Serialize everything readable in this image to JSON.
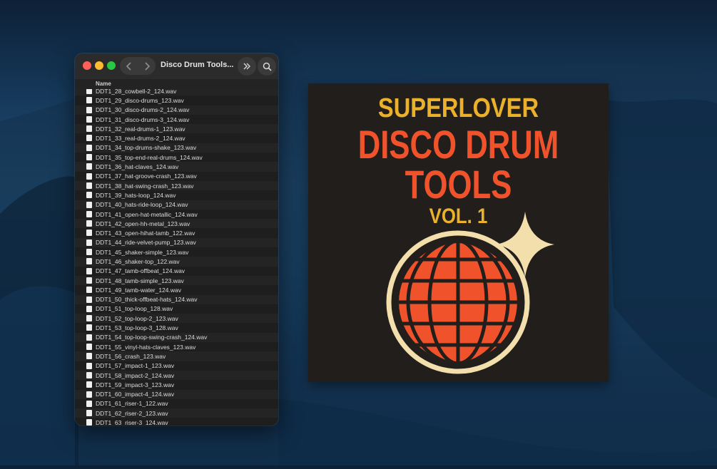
{
  "finder": {
    "title": "Disco Drum Tools...",
    "column_header": "Name",
    "nav_back_icon": "chevron-left-icon",
    "nav_forward_icon": "chevron-right-icon",
    "more_icon": "double-chevron-right-icon",
    "search_icon": "search-icon",
    "files": [
      "DDT1_28_cowbell-2_124.wav",
      "DDT1_29_disco-drums_123.wav",
      "DDT1_30_disco-drums-2_124.wav",
      "DDT1_31_disco-drums-3_124.wav",
      "DDT1_32_real-drums-1_123.wav",
      "DDT1_33_real-drums-2_124.wav",
      "DDT1_34_top-drums-shake_123.wav",
      "DDT1_35_top-end-real-drums_124.wav",
      "DDT1_36_hat-claves_124.wav",
      "DDT1_37_hat-groove-crash_123.wav",
      "DDT1_38_hat-swing-crash_123.wav",
      "DDT1_39_hats-loop_124.wav",
      "DDT1_40_hats-ride-loop_124.wav",
      "DDT1_41_open-hat-metallic_124.wav",
      "DDT1_42_open-hh-metal_123.wav",
      "DDT1_43_open-hihat-tamb_122.wav",
      "DDT1_44_ride-velvet-pump_123.wav",
      "DDT1_45_shaker-simple_123.wav",
      "DDT1_46_shaker-top_122.wav",
      "DDT1_47_tamb-offbeat_124.wav",
      "DDT1_48_tamb-simple_123.wav",
      "DDT1_49_tamb-water_124.wav",
      "DDT1_50_thick-offbeat-hats_124.wav",
      "DDT1_51_top-loop_128.wav",
      "DDT1_52_top-loop-2_123.wav",
      "DDT1_53_top-loop-3_128.wav",
      "DDT1_54_top-loop-swing-crash_124.wav",
      "DDT1_55_vinyl-hats-claves_123.wav",
      "DDT1_56_crash_123.wav",
      "DDT1_57_impact-1_123.wav",
      "DDT1_58_impact-2_124.wav",
      "DDT1_59_impact-3_123.wav",
      "DDT1_60_impact-4_124.wav",
      "DDT1_61_riser-1_122.wav",
      "DDT1_62_riser-2_123.wav",
      "DDT1_63_riser-3_124.wav"
    ]
  },
  "album": {
    "artist": "SUPERLOVER",
    "title_line1": "DISCO DRUM",
    "title_line2": "TOOLS",
    "volume": "VOL. 1",
    "colors": {
      "background": "#221e1b",
      "title": "#f0532c",
      "accent": "#ebb12a",
      "cream": "#f3dfac"
    }
  }
}
